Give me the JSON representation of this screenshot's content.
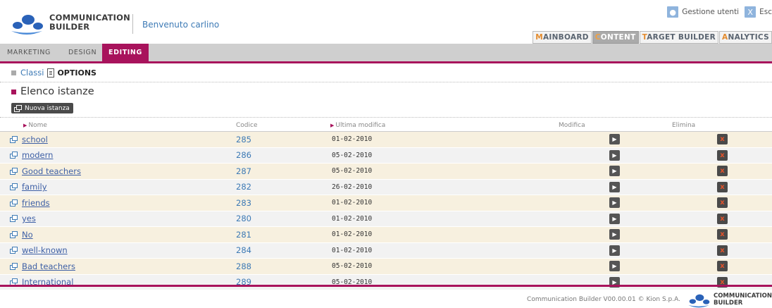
{
  "brand": {
    "line1": "COMMUNICATION",
    "line2": "BUILDER"
  },
  "header": {
    "welcome": "Benvenuto carlino",
    "links": [
      {
        "icon": "users-icon",
        "label": "Gestione utenti"
      },
      {
        "icon": "exit-icon",
        "label": "Esc"
      }
    ]
  },
  "main_tabs": [
    {
      "first": "M",
      "rest": "AINBOARD",
      "active": false
    },
    {
      "first": "C",
      "rest": "ONTENT",
      "active": true
    },
    {
      "first": "T",
      "rest": "ARGET BUILDER",
      "active": false
    },
    {
      "first": "A",
      "rest": "NALYTICS",
      "active": false
    }
  ],
  "sub_tabs": [
    "MARKETING",
    "DESIGN",
    "EDITING"
  ],
  "breadcrumb": {
    "parent": "Classi",
    "current": "OPTIONS"
  },
  "section": {
    "title": "Elenco istanze",
    "new_button": "Nuova istanza"
  },
  "table": {
    "columns": [
      "Nome",
      "Codice",
      "Ultima modifica",
      "Modifica",
      "Elimina"
    ],
    "rows": [
      {
        "name": "school",
        "code": "285",
        "date": "01-02-2010"
      },
      {
        "name": "modern",
        "code": "286",
        "date": "05-02-2010"
      },
      {
        "name": "Good teachers",
        "code": "287",
        "date": "05-02-2010"
      },
      {
        "name": "family",
        "code": "282",
        "date": "26-02-2010"
      },
      {
        "name": "friends",
        "code": "283",
        "date": "01-02-2010"
      },
      {
        "name": "yes",
        "code": "280",
        "date": "01-02-2010"
      },
      {
        "name": "No",
        "code": "281",
        "date": "01-02-2010"
      },
      {
        "name": "well-known",
        "code": "284",
        "date": "01-02-2010"
      },
      {
        "name": "Bad teachers",
        "code": "288",
        "date": "05-02-2010"
      },
      {
        "name": "International",
        "code": "289",
        "date": "05-02-2010"
      }
    ]
  },
  "footer": {
    "text": "Communication Builder V00.00.01 © Kion S.p.A."
  },
  "colors": {
    "accent": "#a8135c",
    "link": "#3d7ab5",
    "row_odd": "#f7f0df",
    "row_even": "#f2f2f2"
  }
}
